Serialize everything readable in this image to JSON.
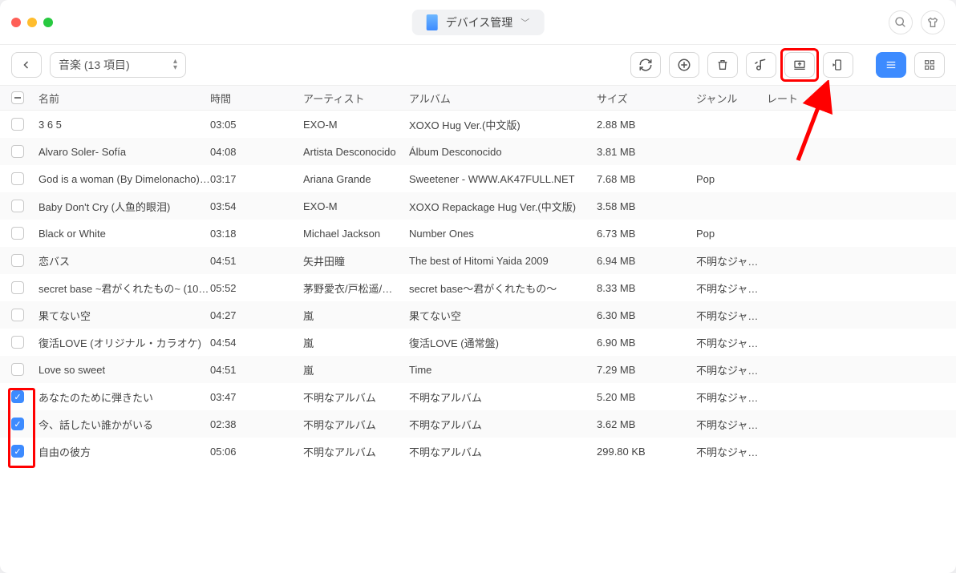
{
  "titlebar": {
    "title": "デバイス管理"
  },
  "toolbar": {
    "category_label": "音楽 (13 項目)"
  },
  "columns": {
    "name": "名前",
    "time": "時間",
    "artist": "アーティスト",
    "album": "アルバム",
    "size": "サイズ",
    "genre": "ジャンル",
    "rate": "レート"
  },
  "rows": [
    {
      "checked": false,
      "name": "3 6 5",
      "time": "03:05",
      "artist": "EXO-M",
      "album": "XOXO Hug Ver.(中文版)",
      "size": "2.88 MB",
      "genre": "",
      "rate": ""
    },
    {
      "checked": false,
      "name": "Alvaro Soler- Sofía",
      "time": "04:08",
      "artist": "Artista Desconocido",
      "album": "Álbum Desconocido",
      "size": "3.81 MB",
      "genre": "",
      "rate": ""
    },
    {
      "checked": false,
      "name": "God is a woman (By Dimelonacho) (W…",
      "time": "03:17",
      "artist": "Ariana Grande",
      "album": "Sweetener - WWW.AK47FULL.NET",
      "size": "7.68 MB",
      "genre": "Pop",
      "rate": ""
    },
    {
      "checked": false,
      "name": "Baby Don't Cry (人鱼的眼泪)",
      "time": "03:54",
      "artist": "EXO-M",
      "album": "XOXO Repackage Hug Ver.(中文版)",
      "size": "3.58 MB",
      "genre": "",
      "rate": ""
    },
    {
      "checked": false,
      "name": "Black or White",
      "time": "03:18",
      "artist": "Michael Jackson",
      "album": "Number Ones",
      "size": "6.73 MB",
      "genre": "Pop",
      "rate": ""
    },
    {
      "checked": false,
      "name": "恋バス",
      "time": "04:51",
      "artist": "矢井田瞳",
      "album": "The best of Hitomi Yaida 2009",
      "size": "6.94 MB",
      "genre": "不明なジャ…",
      "rate": ""
    },
    {
      "checked": false,
      "name": "secret base ~君がくれたもの~ (10 y…",
      "time": "05:52",
      "artist": "茅野愛衣/戸松遥/…",
      "album": "secret base〜君がくれたもの〜",
      "size": "8.33 MB",
      "genre": "不明なジャ…",
      "rate": ""
    },
    {
      "checked": false,
      "name": "果てない空",
      "time": "04:27",
      "artist": "嵐",
      "album": "果てない空",
      "size": "6.30 MB",
      "genre": "不明なジャ…",
      "rate": ""
    },
    {
      "checked": false,
      "name": "復活LOVE (オリジナル・カラオケ)",
      "time": "04:54",
      "artist": "嵐",
      "album": "復活LOVE (通常盤)",
      "size": "6.90 MB",
      "genre": "不明なジャ…",
      "rate": ""
    },
    {
      "checked": false,
      "name": "Love so sweet",
      "time": "04:51",
      "artist": "嵐",
      "album": "Time",
      "size": "7.29 MB",
      "genre": "不明なジャ…",
      "rate": ""
    },
    {
      "checked": true,
      "name": "あなたのために弾きたい",
      "time": "03:47",
      "artist": "不明なアルバム",
      "album": "不明なアルバム",
      "size": "5.20 MB",
      "genre": "不明なジャ…",
      "rate": ""
    },
    {
      "checked": true,
      "name": "今、話したい誰かがいる",
      "time": "02:38",
      "artist": "不明なアルバム",
      "album": "不明なアルバム",
      "size": "3.62 MB",
      "genre": "不明なジャ…",
      "rate": ""
    },
    {
      "checked": true,
      "name": "自由の彼方",
      "time": "05:06",
      "artist": "不明なアルバム",
      "album": "不明なアルバム",
      "size": "299.80 KB",
      "genre": "不明なジャ…",
      "rate": ""
    }
  ]
}
